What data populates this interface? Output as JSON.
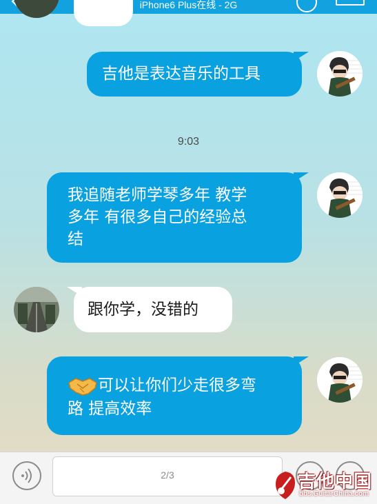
{
  "header": {
    "status": "iPhone6 Plus在线 - 2G"
  },
  "messages": [
    {
      "side": "out",
      "lines": [
        "吉他是表达音乐的工具"
      ]
    },
    {
      "timestamp": "9:03"
    },
    {
      "side": "out",
      "lines": [
        "我追随老师学琴多年  教学",
        "多年  有很多自己的经验总",
        "结"
      ]
    },
    {
      "side": "in",
      "lines": [
        "跟你学，没错的"
      ]
    },
    {
      "side": "out",
      "emoji": "handshake-icon",
      "lines": [
        "可以让你们少走很多弯",
        "路 提高效率"
      ]
    }
  ],
  "input": {
    "page_indicator": "2/3"
  },
  "watermark": {
    "text": "吉他中国",
    "url": "bbs.GuitarChina.com"
  },
  "colors": {
    "accent": "#12a2e0",
    "bubble_out": "#0aa1e0",
    "bubble_in": "#ffffff"
  }
}
